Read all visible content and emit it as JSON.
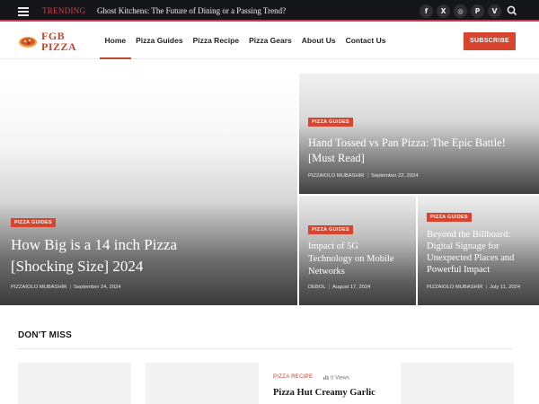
{
  "topbar": {
    "trending_label": "TRENDING",
    "ticker_text": "Ghost Kitchens: The Future of Dining or a Passing Trend?",
    "socials": [
      {
        "icon": "facebook-icon",
        "glyph": "f"
      },
      {
        "icon": "x-icon",
        "glyph": "X"
      },
      {
        "icon": "instagram-icon",
        "glyph": "◎"
      },
      {
        "icon": "pinterest-icon",
        "glyph": "P"
      },
      {
        "icon": "vimeo-icon",
        "glyph": "V"
      }
    ]
  },
  "nav": {
    "logo_line1": "FGB",
    "logo_line2": "PIZZA",
    "items": [
      "Home",
      "Pizza Guides",
      "Pizza Recipe",
      "Pizza Gears",
      "About Us",
      "Contact Us"
    ],
    "subscribe": "SUBSCRIBE"
  },
  "featured": {
    "main": {
      "category": "PIZZA GUIDES",
      "title_line1": "How Big is a 14 inch Pizza",
      "title_line2": "[Shocking Size] 2024",
      "author": "PIZZAIOLO MUBASHIR",
      "date": "September 24, 2024"
    },
    "top_right": {
      "category": "PIZZA GUIDES",
      "title_line1": "Hand Tossed vs Pan Pizza: The Epic Battle!",
      "title_line2": "[Must Read]",
      "author": "PIZZAIOLO MUBASHIR",
      "date": "September 22, 2024"
    },
    "bottom_left": {
      "category": "PIZZA GUIDES",
      "title_line1": "Impact of 5G",
      "title_line2": "Technology on Mobile",
      "title_line3": "Networks",
      "author": "DEBOL",
      "date": "August 17, 2024"
    },
    "bottom_right": {
      "category": "PIZZA GUIDES",
      "title_line1": "Beyond the Billboard:",
      "title_line2": "Digital Signage for",
      "title_line3": "Unexpected Places and",
      "title_line4": "Powerful Impact",
      "author": "PIZZAIOLO MUBASHIR",
      "date": "July 11, 2024"
    }
  },
  "dont_miss": {
    "heading": "DON'T MISS",
    "post": {
      "category": "PIZZA RECIPE",
      "views": "0 Views",
      "title": "Pizza Hut Creamy Garlic"
    }
  },
  "colors": {
    "accent": "#d9442e",
    "topbar_bg": "#15161a",
    "trending": "#d5404f"
  }
}
